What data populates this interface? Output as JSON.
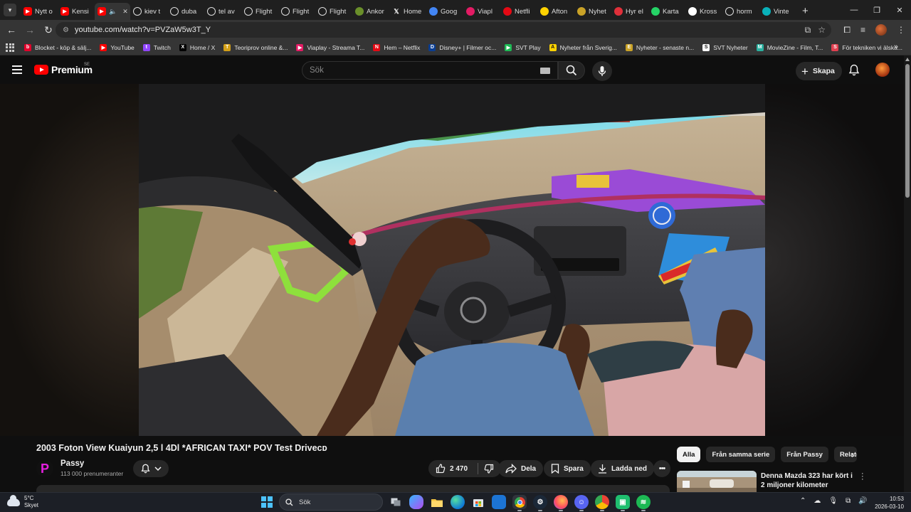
{
  "browser": {
    "tabs": [
      {
        "title": "Nytt o",
        "icon": "youtube",
        "color": "#ff0000"
      },
      {
        "title": "Kensi",
        "icon": "youtube",
        "color": "#ff0000"
      },
      {
        "title": "",
        "icon": "youtube",
        "color": "#ff0000",
        "active": true,
        "audio": true
      },
      {
        "title": "kiev t",
        "icon": "google",
        "color": "#ffffff"
      },
      {
        "title": "duba",
        "icon": "google",
        "color": "#ffffff"
      },
      {
        "title": "tel av",
        "icon": "google",
        "color": "#ffffff"
      },
      {
        "title": "Flight",
        "icon": "flights",
        "color": "#ffffff"
      },
      {
        "title": "Flight",
        "icon": "flights",
        "color": "#ffffff"
      },
      {
        "title": "Flight",
        "icon": "flights",
        "color": "#ffffff"
      },
      {
        "title": "Ankor",
        "icon": "ankor",
        "color": "#6a8f2a"
      },
      {
        "title": "Home",
        "icon": "x",
        "color": "#000000"
      },
      {
        "title": "Goog",
        "icon": "google-maps",
        "color": "#4285f4"
      },
      {
        "title": "Viapl",
        "icon": "viaplay",
        "color": "#e31b64"
      },
      {
        "title": "Netfli",
        "icon": "netflix",
        "color": "#e50914"
      },
      {
        "title": "Afton",
        "icon": "aftonbladet",
        "color": "#ffd200"
      },
      {
        "title": "Nyhet",
        "icon": "news",
        "color": "#c9a227"
      },
      {
        "title": "Hyr el",
        "icon": "hyr",
        "color": "#e0303a"
      },
      {
        "title": "Karta",
        "icon": "whatsapp",
        "color": "#25d366"
      },
      {
        "title": "Kross",
        "icon": "kross",
        "color": "#ffffff"
      },
      {
        "title": "horm",
        "icon": "google",
        "color": "#ffffff"
      },
      {
        "title": "Vinte",
        "icon": "vinted",
        "color": "#09b1ba"
      }
    ],
    "address": "youtube.com/watch?v=PVZaW5w3T_Y",
    "bookmarks": [
      {
        "label": "Blocket - köp & sälj...",
        "color": "#e4002b",
        "glyph": "b"
      },
      {
        "label": "YouTube",
        "color": "#ff0000",
        "glyph": "▶"
      },
      {
        "label": "Twitch",
        "color": "#9146ff",
        "glyph": "t"
      },
      {
        "label": "Home / X",
        "color": "#000000",
        "glyph": "X"
      },
      {
        "label": "Teoriprov online &...",
        "color": "#d4a017",
        "glyph": "T"
      },
      {
        "label": "Viaplay - Streama T...",
        "color": "#e31b64",
        "glyph": "▶"
      },
      {
        "label": "Hem – Netflix",
        "color": "#e50914",
        "glyph": "N"
      },
      {
        "label": "Disney+ | Filmer oc...",
        "color": "#0a3d91",
        "glyph": "D"
      },
      {
        "label": "SVT Play",
        "color": "#1db954",
        "glyph": "▶"
      },
      {
        "label": "Nyheter från Sverig...",
        "color": "#ffd200",
        "glyph": "A"
      },
      {
        "label": "Nyheter - senaste n...",
        "color": "#c9a227",
        "glyph": "E"
      },
      {
        "label": "SVT Nyheter",
        "color": "#ffffff",
        "glyph": "S"
      },
      {
        "label": "MovieZine - Film, T...",
        "color": "#2ab1a0",
        "glyph": "M"
      },
      {
        "label": "För tekniken vi älska...",
        "color": "#e04050",
        "glyph": "S"
      }
    ]
  },
  "youtube": {
    "logo_text": "Premium",
    "region": "SE",
    "search_placeholder": "Sök",
    "create_label": "Skapa",
    "video": {
      "title": "2003 Foton View Kuaiyun 2,5 l 4Dl *AFRICAN TAXI* POV Test Driveᴄᴅ",
      "channel": "Passy",
      "subscribers": "113 000 prenumeranter",
      "likes": "2 470",
      "share": "Dela",
      "save": "Spara",
      "download": "Ladda ned"
    },
    "chips": [
      "Alla",
      "Från samma serie",
      "Från Passy",
      "Relaterat"
    ],
    "recommendation": {
      "title": "Denna Mazda 323 har kört i 2 miljoner kilometer"
    }
  },
  "taskbar": {
    "temperature": "5°C",
    "condition": "Skyet",
    "search_label": "Sök",
    "time": "10:53",
    "date": "2026-03-10"
  }
}
